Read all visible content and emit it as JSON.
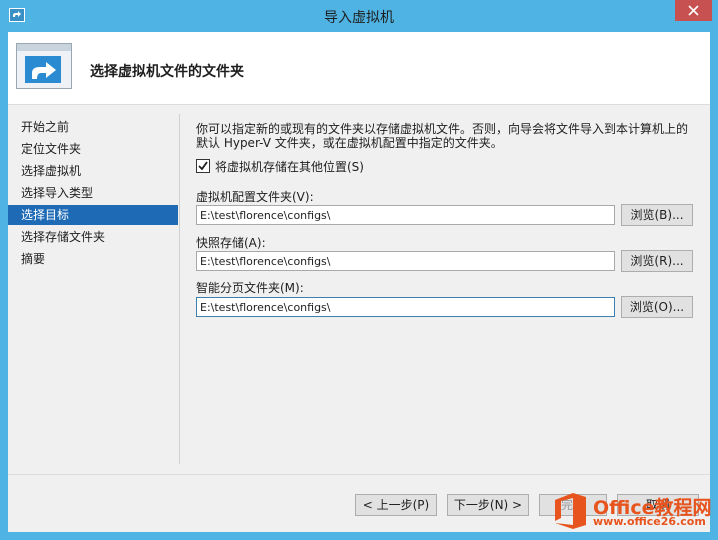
{
  "window": {
    "title": "导入虚拟机",
    "icons": {
      "app": "hyper-v-icon",
      "close": "close-icon"
    },
    "accent_color": "#4fb4e3"
  },
  "header": {
    "title": "选择虚拟机文件的文件夹",
    "icon": "import-arrow-icon"
  },
  "nav": {
    "items": [
      {
        "label": "开始之前",
        "selected": false
      },
      {
        "label": "定位文件夹",
        "selected": false
      },
      {
        "label": "选择虚拟机",
        "selected": false
      },
      {
        "label": "选择导入类型",
        "selected": false
      },
      {
        "label": "选择目标",
        "selected": true
      },
      {
        "label": "选择存储文件夹",
        "selected": false
      },
      {
        "label": "摘要",
        "selected": false
      }
    ],
    "selected_color": "#1f6ab5"
  },
  "main": {
    "description_line1": "你可以指定新的或现有的文件夹以存储虚拟机文件。否则，向导会将文件导入到本计算机上的",
    "description_line2": "默认 Hyper-V 文件夹，或在虚拟机配置中指定的文件夹。",
    "checkbox": {
      "label": "将虚拟机存储在其他位置(S)",
      "checked": true
    },
    "fields": [
      {
        "label": "虚拟机配置文件夹(V):",
        "value": "E:\\test\\florence\\configs\\",
        "browse_label": "浏览(B)..."
      },
      {
        "label": "快照存储(A):",
        "value": "E:\\test\\florence\\configs\\",
        "browse_label": "浏览(R)..."
      },
      {
        "label": "智能分页文件夹(M):",
        "value": "E:\\test\\florence\\configs\\",
        "browse_label": "浏览(O)..."
      }
    ]
  },
  "footer": {
    "prev_label": "< 上一步(P)",
    "next_label": "下一步(N) >",
    "finish_label": "完成",
    "cancel_label": "取消"
  },
  "watermark": {
    "brand": "Office教程网",
    "url": "www.office26.com",
    "logo": "office-logo-icon",
    "color": "#e8541d"
  }
}
